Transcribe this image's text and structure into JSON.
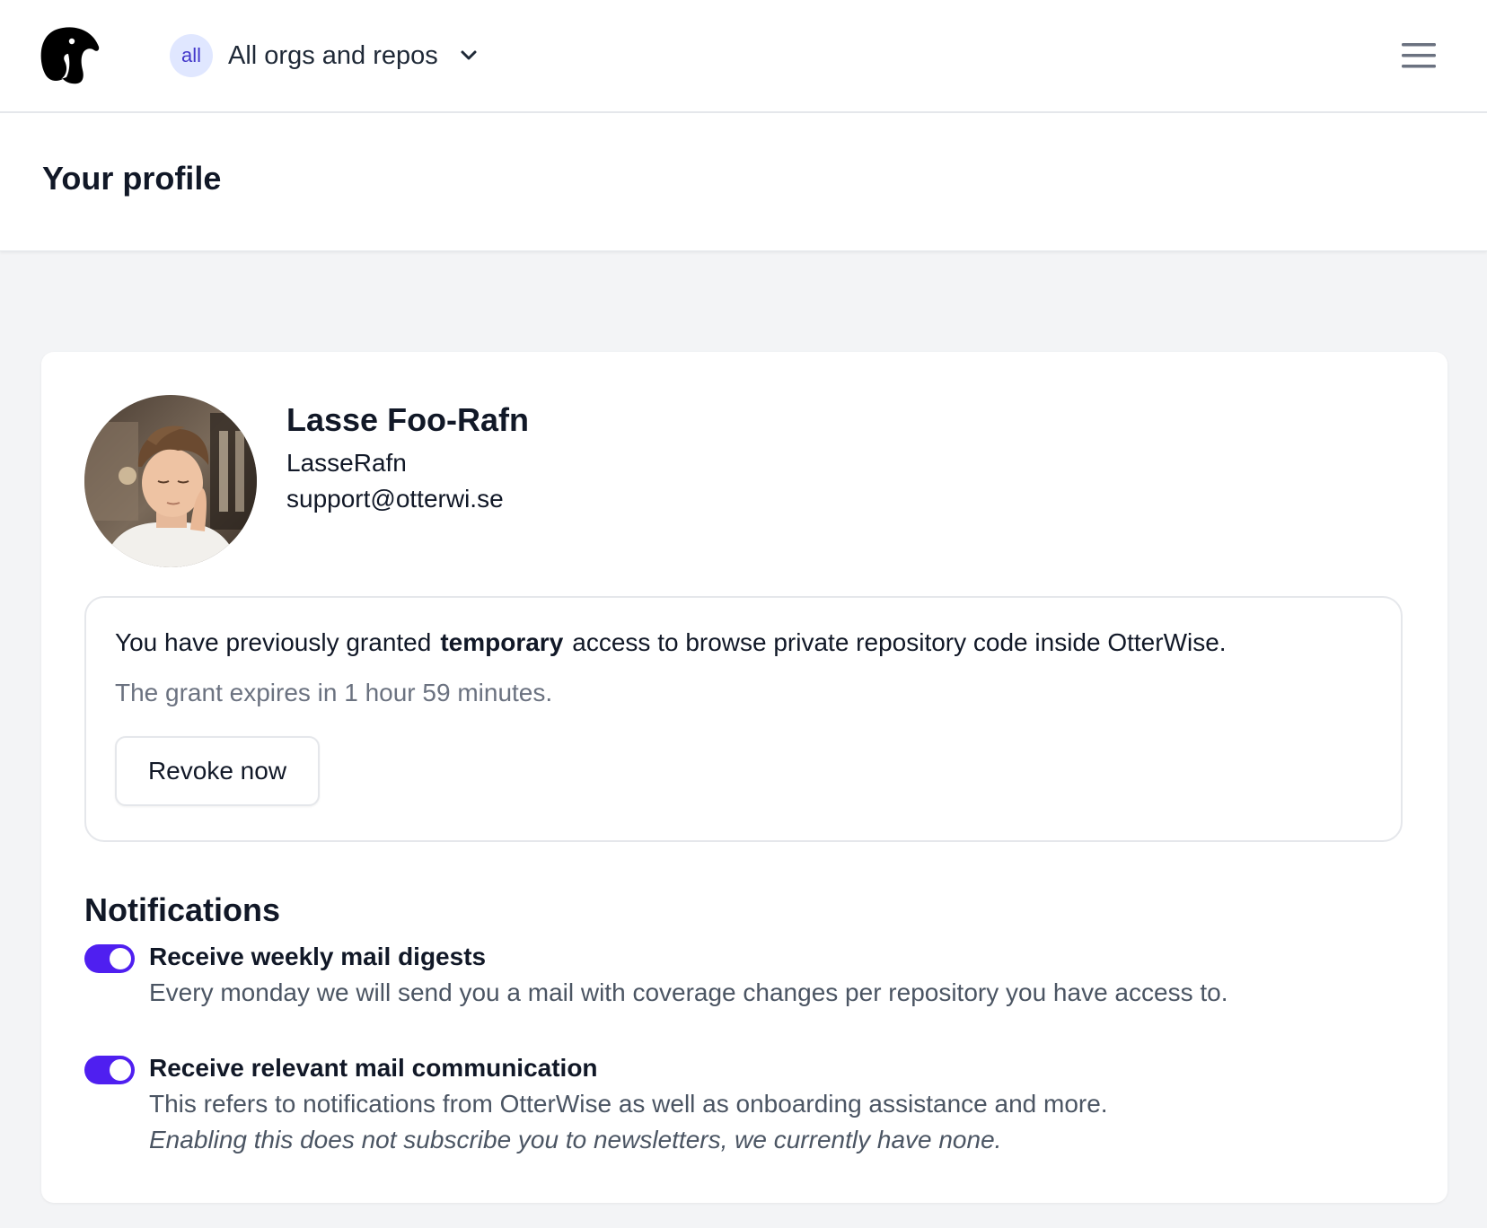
{
  "nav": {
    "logo_icon": "otter-logo-icon",
    "scope_badge": "all",
    "scope_label": "All orgs and repos",
    "scope_chevron_icon": "chevron-down-icon",
    "menu_icon": "hamburger-menu-icon"
  },
  "page": {
    "title": "Your profile"
  },
  "profile": {
    "name": "Lasse Foo-Rafn",
    "username": "LasseRafn",
    "email": "support@otterwi.se",
    "avatar_icon": "avatar-photo"
  },
  "grant": {
    "text_before": "You have previously granted",
    "text_emphasis": "temporary",
    "text_after": "access to browse private repository code inside OtterWise.",
    "expiry": "The grant expires in 1 hour 59 minutes.",
    "revoke_label": "Revoke now"
  },
  "notifications": {
    "title": "Notifications",
    "items": [
      {
        "label": "Receive weekly mail digests",
        "description": "Every monday we will send you a mail with coverage changes per repository you have access to.",
        "enabled": true
      },
      {
        "label": "Receive relevant mail communication",
        "description": "This refers to notifications from OtterWise as well as onboarding assistance and more.",
        "note": "Enabling this does not subscribe you to newsletters, we currently have none.",
        "enabled": true
      }
    ]
  },
  "colors": {
    "accent": "#4f1ff0",
    "badge_bg": "#e0e7ff",
    "badge_text": "#4338ca",
    "page_bg": "#f3f4f6"
  }
}
